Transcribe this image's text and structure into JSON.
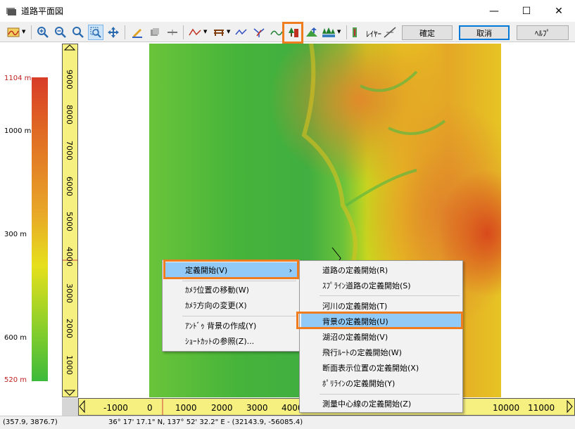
{
  "window": {
    "title": "道路平面図",
    "minimize": "—",
    "maximize": "☐",
    "close": "✕"
  },
  "toolbar": {
    "confirm_label": "確定",
    "cancel_label": "取消",
    "help_label": "ﾍﾙﾌﾟ",
    "layer_label": "ﾚｲﾔｰ"
  },
  "legend": {
    "labels": [
      "1104 m",
      "1000 m",
      "300 m",
      "600 m",
      "520 m"
    ]
  },
  "vruler": {
    "ticks": [
      "9000",
      "8000",
      "7000",
      "6000",
      "5000",
      "4000",
      "3000",
      "2000",
      "1000"
    ]
  },
  "hruler": {
    "ticks": [
      "-1000",
      "0",
      "1000",
      "2000",
      "3000",
      "4000",
      "10000",
      "11000"
    ]
  },
  "status": {
    "coords": "(357.9, 3876.7)",
    "latlon": "36° 17' 17.1\" N, 137° 52' 32.2\" E  -  (32143.9, -56085.4)"
  },
  "context_menu": {
    "items": [
      "定義開始(V)",
      "ｶﾒﾗ位置の移動(W)",
      "ｶﾒﾗ方向の変更(X)",
      "ｱﾝﾄﾞｩ 背景の作成(Y)",
      "ｼｮｰﾄｶｯﾄの参照(Z)..."
    ],
    "arrow": "›"
  },
  "submenu": {
    "items": [
      "道路の定義開始(R)",
      "ｽﾌﾟﾗｲﾝ道路の定義開始(S)",
      "河川の定義開始(T)",
      "背景の定義開始(U)",
      "湖沼の定義開始(V)",
      "飛行ﾙｰﾄの定義開始(W)",
      "断面表示位置の定義開始(X)",
      "ﾎﾟﾘﾗｲﾝの定義開始(Y)",
      "測量中心線の定義開始(Z)"
    ]
  },
  "colors": {
    "accent": "#f07c20",
    "menu_highlight": "#91c9f7",
    "ruler": "#f6f080"
  }
}
